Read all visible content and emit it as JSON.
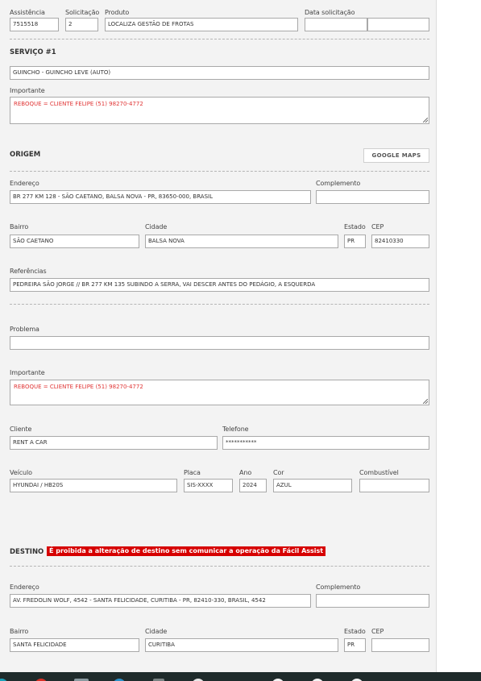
{
  "header": {
    "assistencia": {
      "label": "Assistência",
      "value": "7515518"
    },
    "solicitacao": {
      "label": "Solicitação",
      "value": "2"
    },
    "produto": {
      "label": "Produto",
      "value": "LOCALIZA GESTÃO DE FROTAS"
    },
    "data_solicitacao": {
      "label": "Data solicitação",
      "value_date": "",
      "value_time": ""
    }
  },
  "servico": {
    "title": "SERVIÇO #1",
    "value": "GUINCHO - GUINCHO LEVE (AUTO)",
    "importante_label": "Importante",
    "importante_value": "REBOQUE = CLIENTE FELIPE (51) 98270-4772"
  },
  "origem": {
    "title": "ORIGEM",
    "maps_button": "GOOGLE MAPS",
    "endereco": {
      "label": "Endereço",
      "value": "BR 277 KM 128 - SÃO CAETANO, BALSA NOVA - PR, 83650-000, BRASIL"
    },
    "complemento": {
      "label": "Complemento",
      "value": ""
    },
    "bairro": {
      "label": "Bairro",
      "value": "SÃO CAETANO"
    },
    "cidade": {
      "label": "Cidade",
      "value": "BALSA NOVA"
    },
    "estado": {
      "label": "Estado",
      "value": "PR"
    },
    "cep": {
      "label": "CEP",
      "value": "82410330"
    },
    "referencias": {
      "label": "Referências",
      "value": "PEDREIRA SÃO JORGE // BR 277 KM 135 SUBINDO A SERRA, VAI DESCER ANTES DO PEDÁGIO, A ESQUERDA"
    }
  },
  "detalhes": {
    "problema": {
      "label": "Problema",
      "value": ""
    },
    "importante": {
      "label": "Importante",
      "value": "REBOQUE = CLIENTE FELIPE (51) 98270-4772"
    },
    "cliente": {
      "label": "Cliente",
      "value": "RENT A CAR"
    },
    "telefone": {
      "label": "Telefone",
      "value": "***********"
    },
    "veiculo": {
      "label": "Veículo",
      "value": "HYUNDAI / HB20S"
    },
    "placa": {
      "label": "Placa",
      "value": "SIS-XXXX"
    },
    "ano": {
      "label": "Ano",
      "value": "2024"
    },
    "cor": {
      "label": "Cor",
      "value": "AZUL"
    },
    "combustivel": {
      "label": "Combustível",
      "value": ""
    }
  },
  "destino": {
    "title": "DESTINO",
    "warning": "É proibida a alteração de destino sem comunicar a operação da Fácil Assist",
    "endereco": {
      "label": "Endereço",
      "value": "AV. FREDOLIN WOLF, 4542 - SANTA FELICIDADE, CURITIBA - PR, 82410-330, BRASIL, 4542"
    },
    "complemento": {
      "label": "Complemento",
      "value": ""
    },
    "bairro": {
      "label": "Bairro",
      "value": "SANTA FELICIDADE"
    },
    "cidade": {
      "label": "Cidade",
      "value": "CURITIBA"
    },
    "estado": {
      "label": "Estado",
      "value": "PR"
    },
    "cep": {
      "label": "CEP",
      "value": ""
    }
  },
  "colors": {
    "warning_bg": "#d60000",
    "important_text": "#e03535",
    "panel_bg": "#f3f3f3",
    "taskbar_bg": "#1f2b2b"
  },
  "taskbar": {
    "icons": [
      "browser-icon",
      "chrome-icon",
      "file-explorer-icon",
      "edge-icon",
      "app-icon",
      "chrome-icon",
      "chrome-icon",
      "chrome-icon",
      "chrome-icon"
    ]
  }
}
